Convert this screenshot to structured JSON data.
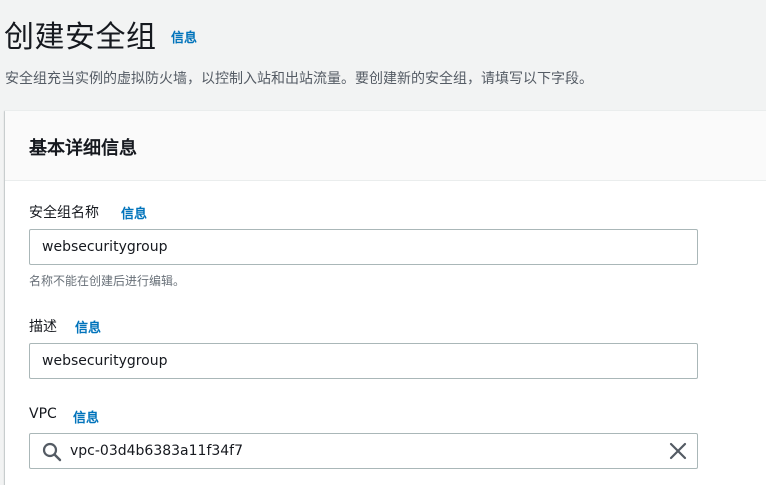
{
  "header": {
    "title": "创建安全组",
    "info_link": "信息",
    "description": "安全组充当实例的虚拟防火墙，以控制入站和出站流量。要创建新的安全组，请填写以下字段。"
  },
  "panel": {
    "title": "基本详细信息",
    "name_field": {
      "label": "安全组名称",
      "info_link": "信息",
      "value": "websecuritygroup",
      "constraint": "名称不能在创建后进行编辑。"
    },
    "description_field": {
      "label": "描述",
      "info_link": "信息",
      "value": "websecuritygroup"
    },
    "vpc_field": {
      "label": "VPC",
      "info_link": "信息",
      "value": "vpc-03d4b6383a11f34f7",
      "search_icon": "search-icon",
      "clear_icon": "close-icon"
    }
  },
  "colors": {
    "link": "#0073bb",
    "background": "#f2f3f3",
    "panel_header": "#fafafa",
    "input_border": "#aab7b8"
  }
}
